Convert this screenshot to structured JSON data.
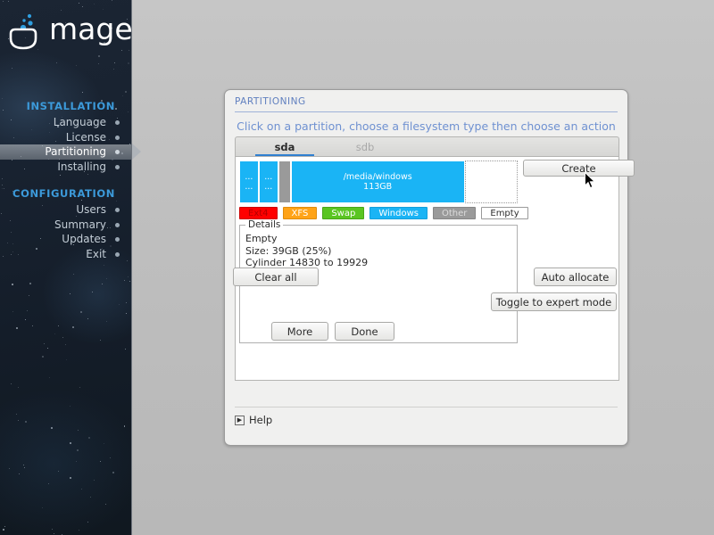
{
  "brand": {
    "name": "mageia",
    "logo_icon": "mageia-cauldron-logo"
  },
  "sidebar": {
    "sections": [
      {
        "heading": "INSTALLATION",
        "items": [
          {
            "label": "Language",
            "active": false
          },
          {
            "label": "License",
            "active": false
          },
          {
            "label": "Partitioning",
            "active": true
          },
          {
            "label": "Installing",
            "active": false
          }
        ]
      },
      {
        "heading": "CONFIGURATION",
        "items": [
          {
            "label": "Users",
            "active": false
          },
          {
            "label": "Summary",
            "active": false
          },
          {
            "label": "Updates",
            "active": false
          },
          {
            "label": "Exit",
            "active": false
          }
        ]
      }
    ]
  },
  "dialog": {
    "title": "PARTITIONING",
    "instruction": "Click on a partition, choose a filesystem type then choose an action",
    "tabs": [
      {
        "label": "sda",
        "active": true
      },
      {
        "label": "sdb",
        "active": false
      }
    ],
    "partition_bar": {
      "segments": [
        {
          "label": "...\n...",
          "type": "windows",
          "width_pct": 7.0
        },
        {
          "label": "...\n...",
          "type": "windows",
          "width_pct": 7.0
        },
        {
          "label": "",
          "type": "other",
          "width_pct": 4.5
        },
        {
          "label": "/media/windows\n113GB",
          "type": "windows",
          "width_pct": 62.5
        },
        {
          "label": "",
          "type": "empty",
          "width_pct": 19.0
        }
      ]
    },
    "legend": [
      {
        "label": "Ext4",
        "key": "ext4"
      },
      {
        "label": "XFS",
        "key": "xfs"
      },
      {
        "label": "Swap",
        "key": "swap"
      },
      {
        "label": "Windows",
        "key": "windows"
      },
      {
        "label": "Other",
        "key": "other"
      },
      {
        "label": "Empty",
        "key": "empty"
      }
    ],
    "details": {
      "legend": "Details",
      "text": "Empty\nSize: 39GB (25%)\nCylinder 14830 to 19929"
    },
    "actions": {
      "create": "Create",
      "clear_all": "Clear all",
      "auto_allocate": "Auto allocate",
      "toggle_expert": "Toggle to expert mode"
    },
    "footer": {
      "help": "Help",
      "help_icon": "expander-triangle-icon",
      "more": "More",
      "done": "Done"
    }
  },
  "colors": {
    "accent_blue": "#3c9ada",
    "title_blue": "#5f7fbf",
    "instruction_blue": "#6f91d1",
    "windows": "#1ab4f5",
    "other": "#9a9a9a",
    "ext4": "#ff0000",
    "xfs": "#ffa317",
    "swap": "#5ac521",
    "tab_underline": "#2f7fd0"
  },
  "cursor": {
    "icon": "arrow-pointer-icon"
  }
}
